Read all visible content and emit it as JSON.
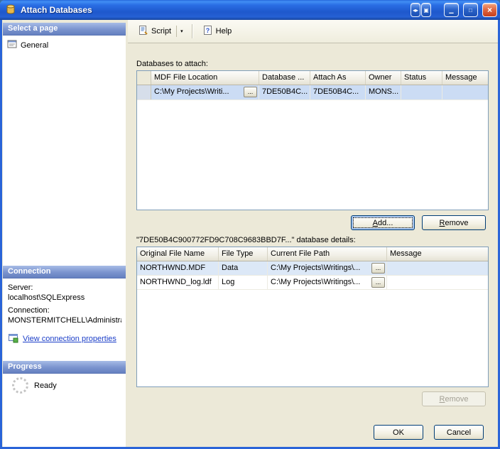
{
  "window": {
    "title": "Attach Databases"
  },
  "titlebar_buttons": [
    {
      "name": "dock-arrows",
      "glyph": "◂▸"
    },
    {
      "name": "restore",
      "glyph": "▣"
    },
    {
      "name": "minimize",
      "glyph": "▁"
    },
    {
      "name": "maximize",
      "glyph": "□"
    },
    {
      "name": "close",
      "glyph": "×"
    }
  ],
  "sidebar": {
    "select_page": {
      "header": "Select a page",
      "general_label": "General"
    },
    "connection": {
      "header": "Connection",
      "server_label": "Server:",
      "server_value": "localhost\\SQLExpress",
      "connection_label": "Connection:",
      "connection_value": "MONSTERMITCHELL\\Administra",
      "view_link": "View connection properties"
    },
    "progress": {
      "header": "Progress",
      "status": "Ready"
    }
  },
  "toolbar": {
    "script_label": "Script",
    "help_label": "Help",
    "dropdown_glyph": "▾"
  },
  "main": {
    "attach_label": "Databases to attach:",
    "attach_table": {
      "columns": [
        "MDF File Location",
        "Database ...",
        "Attach As",
        "Owner",
        "Status",
        "Message"
      ],
      "rows": [
        {
          "mdf": "C:\\My Projects\\Writi...",
          "database": "7DE50B4C...",
          "attach_as": "7DE50B4C...",
          "owner": "MONS...",
          "status": "",
          "message": ""
        }
      ]
    },
    "add_button": "Add...",
    "remove_button": "Remove",
    "details_label": "\"7DE50B4C900772FD9C708C9683BBD7F...\" database details:",
    "details_table": {
      "columns": [
        "Original File Name",
        "File Type",
        "Current File Path",
        "Message"
      ],
      "rows": [
        {
          "name": "NORTHWND.MDF",
          "type": "Data",
          "path": "C:\\My Projects\\Writings\\...",
          "message": ""
        },
        {
          "name": "NORTHWND_log.ldf",
          "type": "Log",
          "path": "C:\\My Projects\\Writings\\...",
          "message": ""
        }
      ]
    },
    "details_remove_button": "Remove"
  },
  "footer": {
    "ok": "OK",
    "cancel": "Cancel"
  },
  "icons": {
    "browse": "..."
  },
  "colors": {
    "link-color": "#1B3EC8",
    "selection-color": "#CBDCF4",
    "selection-light": "#DCE8F7",
    "titlebar-blue": "#2668DC",
    "close-red": "#D8502E"
  }
}
